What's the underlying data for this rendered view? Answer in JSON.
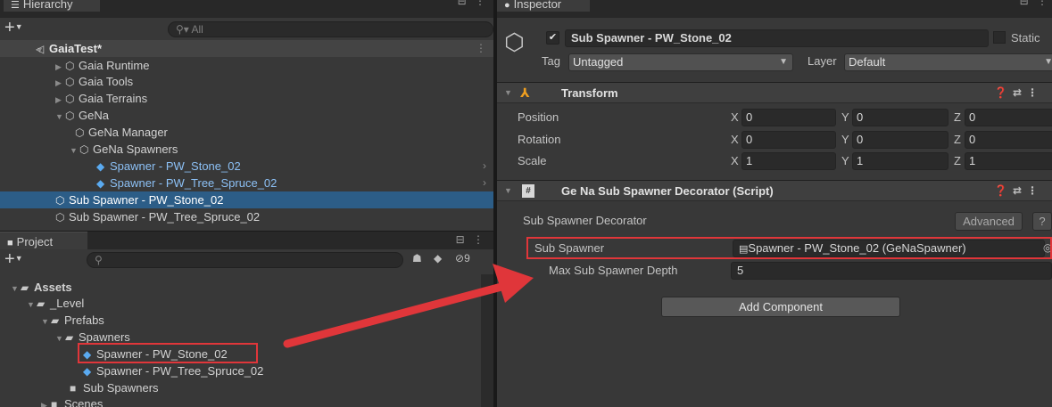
{
  "hierarchy": {
    "tab_label": "Hierarchy",
    "search_placeholder": "All",
    "scene_name": "GaiaTest*",
    "items": [
      {
        "label": "Gaia Runtime"
      },
      {
        "label": "Gaia Tools"
      },
      {
        "label": "Gaia Terrains"
      },
      {
        "label": "GeNa"
      },
      {
        "label": "GeNa Manager"
      },
      {
        "label": "GeNa Spawners"
      },
      {
        "label": "Spawner - PW_Stone_02"
      },
      {
        "label": "Spawner - PW_Tree_Spruce_02"
      },
      {
        "label": "Sub Spawner - PW_Stone_02"
      },
      {
        "label": "Sub Spawner - PW_Tree_Spruce_02"
      }
    ]
  },
  "project": {
    "tab_label": "Project",
    "hidden_count": "9",
    "items": [
      {
        "label": "Assets"
      },
      {
        "label": "_Level"
      },
      {
        "label": "Prefabs"
      },
      {
        "label": "Spawners"
      },
      {
        "label": "Spawner - PW_Stone_02"
      },
      {
        "label": "Spawner - PW_Tree_Spruce_02"
      },
      {
        "label": "Sub Spawners"
      },
      {
        "label": "Scenes"
      }
    ]
  },
  "inspector": {
    "tab_label": "Inspector",
    "object_name": "Sub Spawner - PW_Stone_02",
    "static_label": "Static",
    "tag_label": "Tag",
    "tag_value": "Untagged",
    "layer_label": "Layer",
    "layer_value": "Default",
    "transform": {
      "title": "Transform",
      "rows": [
        {
          "label": "Position",
          "x": "0",
          "y": "0",
          "z": "0"
        },
        {
          "label": "Rotation",
          "x": "0",
          "y": "0",
          "z": "0"
        },
        {
          "label": "Scale",
          "x": "1",
          "y": "1",
          "z": "1"
        }
      ],
      "axis": {
        "x": "X",
        "y": "Y",
        "z": "Z"
      }
    },
    "script": {
      "title": "Ge Na Sub Spawner Decorator (Script)",
      "section_label": "Sub Spawner Decorator",
      "advanced_label": "Advanced",
      "help_label": "?",
      "sub_spawner_label": "Sub Spawner",
      "sub_spawner_value": "Spawner - PW_Stone_02 (GeNaSpawner)",
      "depth_label": "Max Sub Spawner Depth",
      "depth_value": "5"
    },
    "add_component_label": "Add Component"
  },
  "colors": {
    "selection": "#2c5d87",
    "annotation": "#e0363a",
    "prefab_text": "#8cc0f5"
  }
}
